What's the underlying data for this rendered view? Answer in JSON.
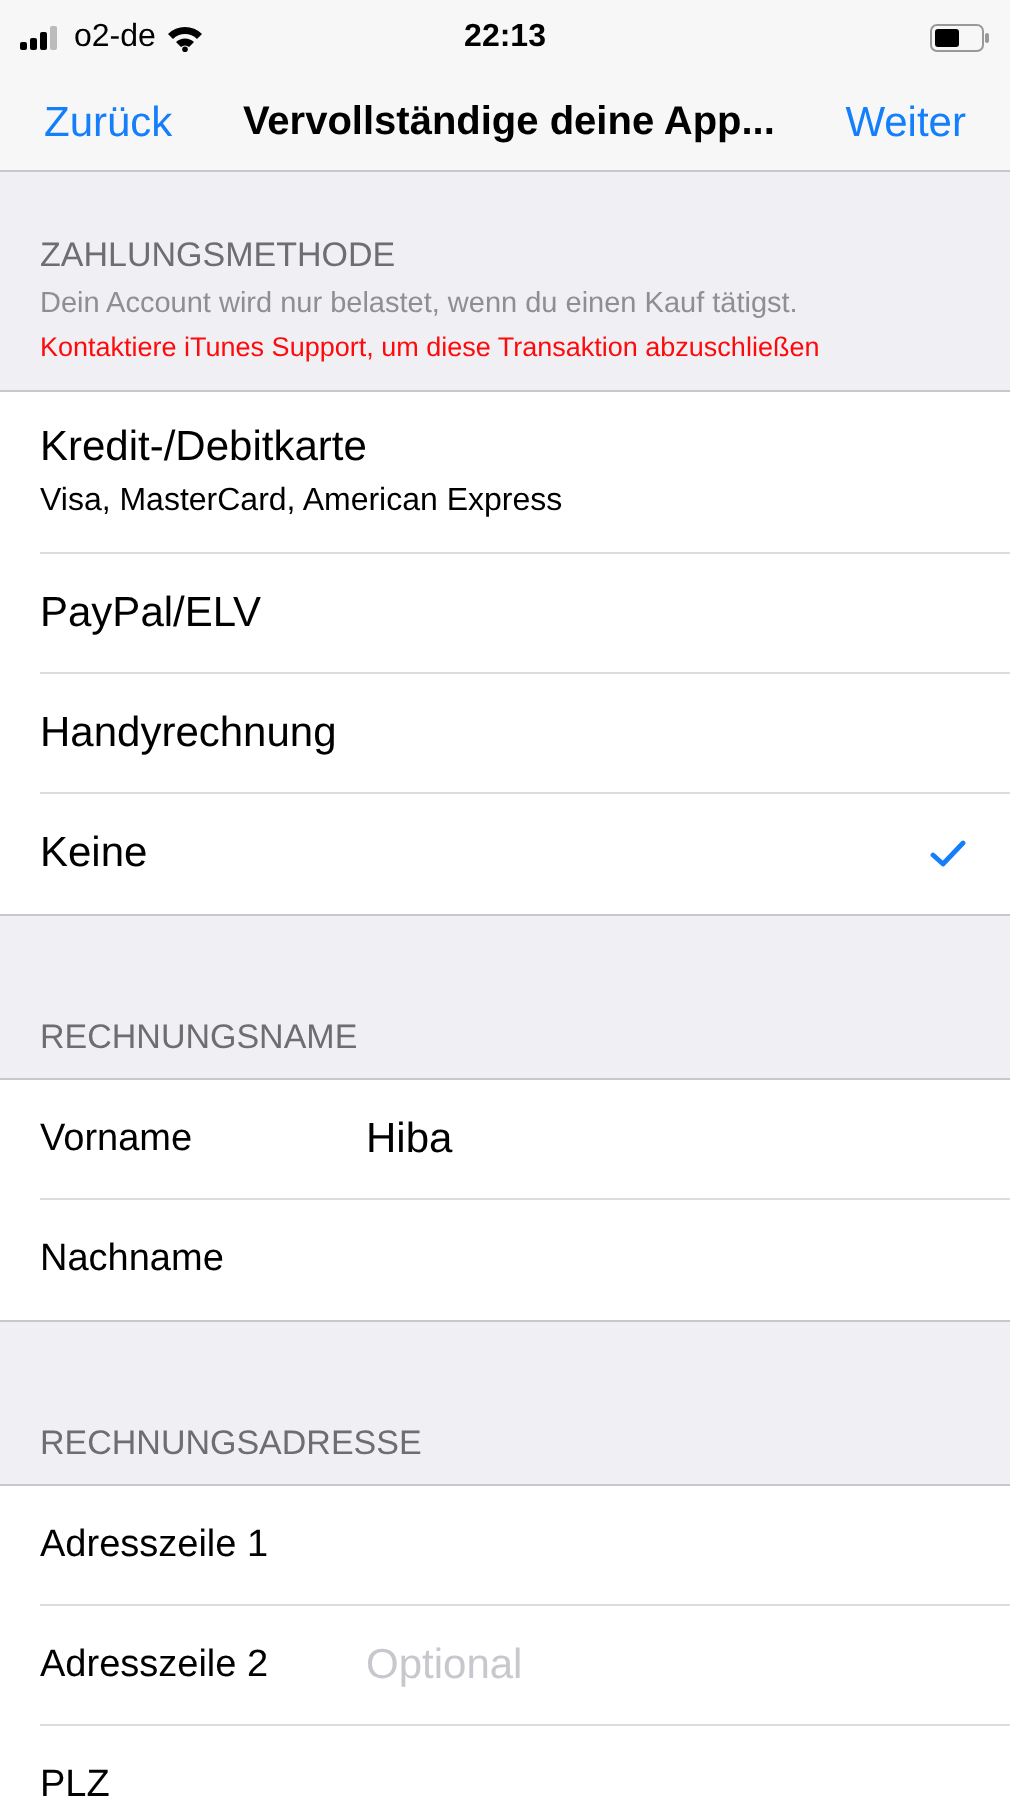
{
  "status_bar": {
    "carrier": "o2-de",
    "time": "22:13"
  },
  "nav": {
    "back": "Zurück",
    "title": "Vervollständige deine App...",
    "next": "Weiter"
  },
  "payment_method": {
    "header": "ZAHLUNGSMETHODE",
    "note": "Dein Account wird nur belastet, wenn du einen Kauf tätigst.",
    "warning": "Kontaktiere iTunes Support, um diese Transaktion abzuschließen",
    "options": [
      {
        "label": "Kredit-/Debitkarte",
        "detail": "Visa, MasterCard, American Express",
        "selected": false
      },
      {
        "label": "PayPal/ELV",
        "selected": false
      },
      {
        "label": "Handyrechnung",
        "selected": false
      },
      {
        "label": "Keine",
        "selected": true
      }
    ]
  },
  "billing_name": {
    "header": "RECHNUNGSNAME",
    "fields": [
      {
        "label": "Vorname",
        "value": "Hiba"
      },
      {
        "label": "Nachname"
      }
    ]
  },
  "billing_address": {
    "header": "RECHNUNGSADRESSE",
    "fields": [
      {
        "label": "Adresszeile 1"
      },
      {
        "label": "Adresszeile 2",
        "placeholder": "Optional"
      },
      {
        "label": "PLZ"
      }
    ]
  }
}
